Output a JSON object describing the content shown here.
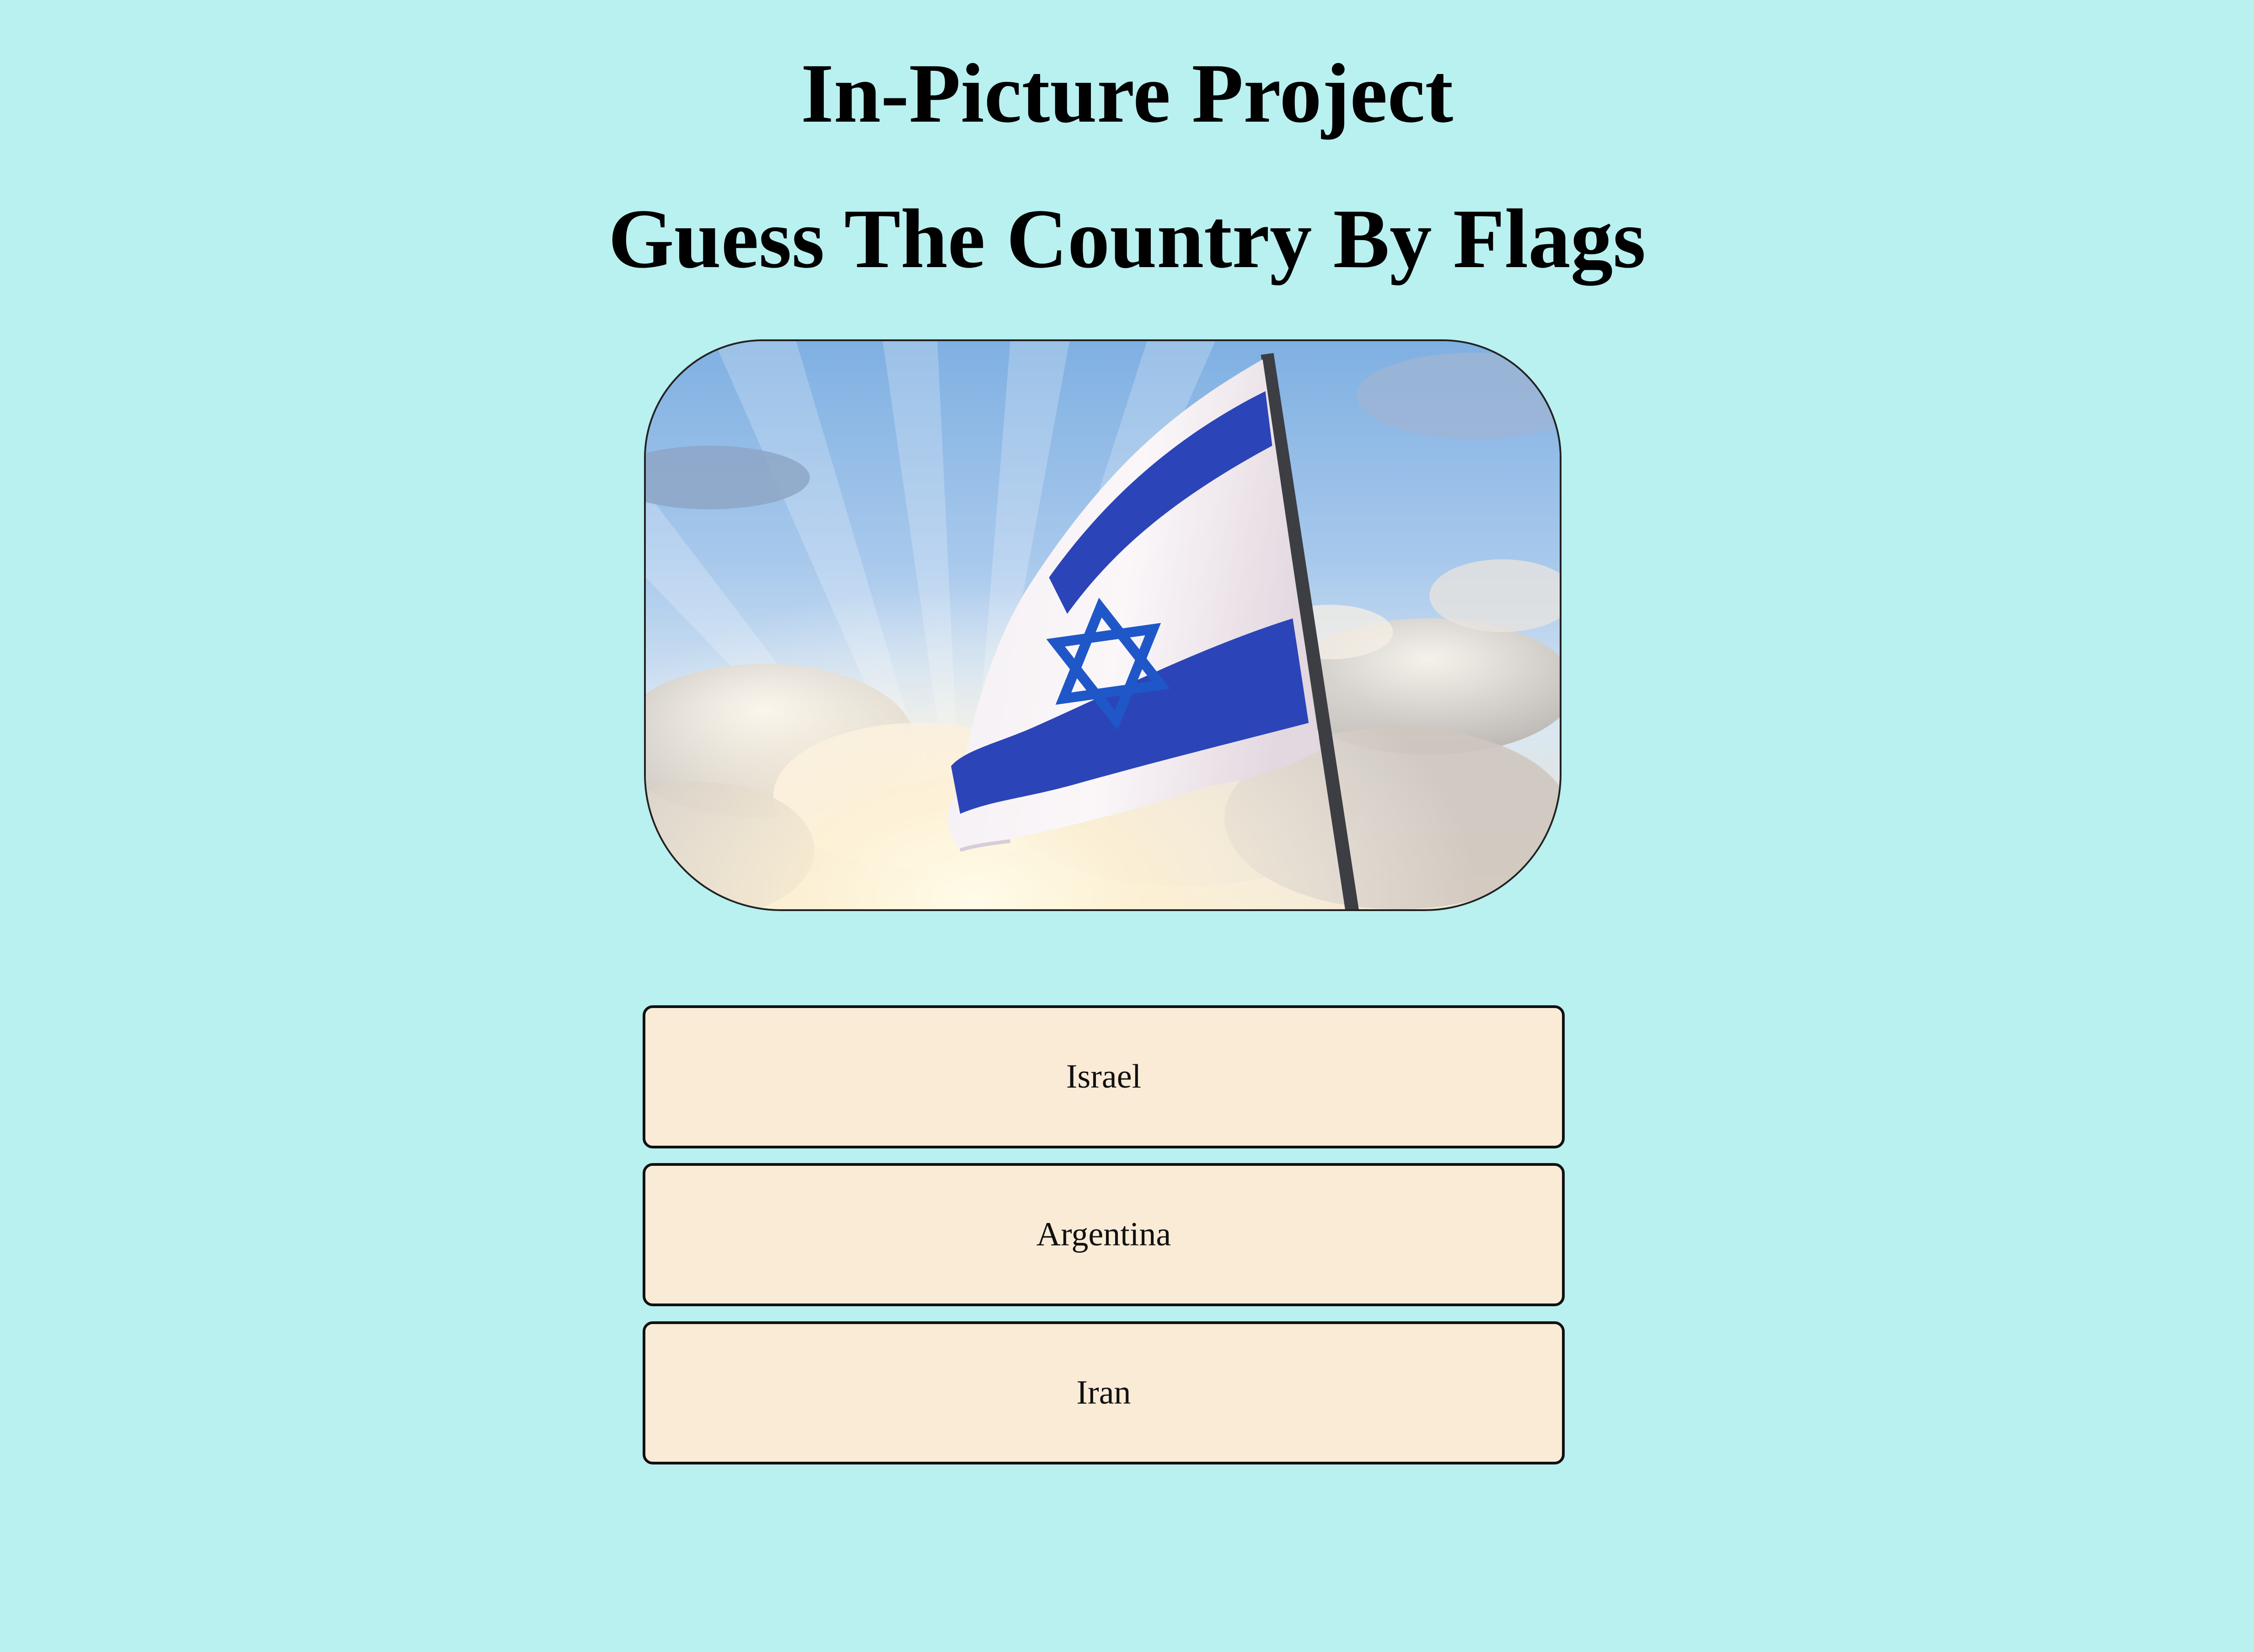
{
  "title": "In-Picture Project",
  "subtitle": "Guess The Country By Flags",
  "question_image": {
    "subject": "flag-photo",
    "colors": {
      "page_background": "#b9f0f0",
      "answer_background": "#faebd7",
      "flag_blue": "#2b45b8",
      "star_blue": "#1f57c8"
    }
  },
  "answers": [
    {
      "label": "Israel"
    },
    {
      "label": "Argentina"
    },
    {
      "label": "Iran"
    }
  ]
}
